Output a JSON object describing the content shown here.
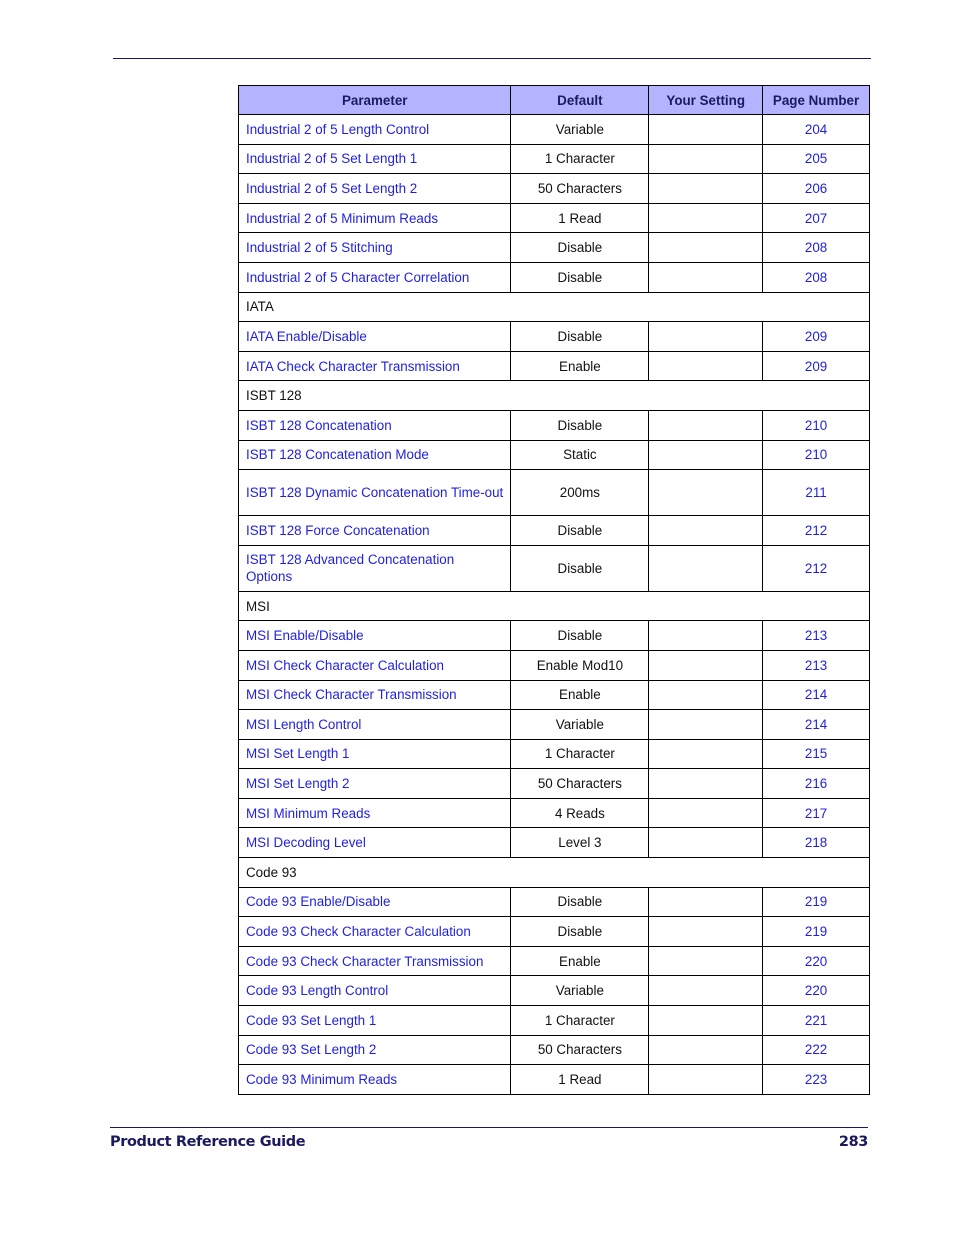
{
  "header": {
    "columns": [
      "Parameter",
      "Default",
      "Your Setting",
      "Page Number"
    ]
  },
  "rows": [
    {
      "type": "param",
      "parameter": "Industrial 2 of 5 Length Control",
      "default": "Variable",
      "setting": "",
      "page": "204"
    },
    {
      "type": "param",
      "parameter": "Industrial 2 of 5 Set Length 1",
      "default": "1 Character",
      "setting": "",
      "page": "205"
    },
    {
      "type": "param",
      "parameter": "Industrial 2 of 5 Set Length 2",
      "default": "50 Characters",
      "setting": "",
      "page": "206"
    },
    {
      "type": "param",
      "parameter": "Industrial 2 of 5 Minimum Reads",
      "default": "1 Read",
      "setting": "",
      "page": "207"
    },
    {
      "type": "param",
      "parameter": "Industrial 2 of 5 Stitching",
      "default": "Disable",
      "setting": "",
      "page": "208"
    },
    {
      "type": "param",
      "parameter": "Industrial 2 of 5 Character Correlation",
      "default": "Disable",
      "setting": "",
      "page": "208"
    },
    {
      "type": "section",
      "label": "IATA"
    },
    {
      "type": "param",
      "parameter": "IATA Enable/Disable",
      "default": "Disable",
      "setting": "",
      "page": "209"
    },
    {
      "type": "param",
      "parameter": "IATA Check Character Transmission",
      "default": "Enable",
      "setting": "",
      "page": "209"
    },
    {
      "type": "section",
      "label": "ISBT 128"
    },
    {
      "type": "param",
      "parameter": "ISBT 128 Concatenation",
      "default": "Disable",
      "setting": "",
      "page": "210"
    },
    {
      "type": "param",
      "parameter": "ISBT 128 Concatenation Mode",
      "default": "Static",
      "setting": "",
      "page": "210"
    },
    {
      "type": "param",
      "tall": true,
      "parameter": "ISBT 128 Dynamic Concatenation Time-out",
      "default": "200ms",
      "setting": "",
      "page": "211"
    },
    {
      "type": "param",
      "parameter": "ISBT 128 Force Concatenation",
      "default": "Disable",
      "setting": "",
      "page": "212"
    },
    {
      "type": "param",
      "tall": true,
      "parameter": "ISBT 128 Advanced Concatenation Options",
      "default": "Disable",
      "setting": "",
      "page": "212"
    },
    {
      "type": "section",
      "label": "MSI"
    },
    {
      "type": "param",
      "parameter": "MSI Enable/Disable",
      "default": "Disable",
      "setting": "",
      "page": "213"
    },
    {
      "type": "param",
      "parameter": "MSI Check Character Calculation",
      "default": "Enable Mod10",
      "setting": "",
      "page": "213"
    },
    {
      "type": "param",
      "parameter": "MSI Check Character Transmission",
      "default": "Enable",
      "setting": "",
      "page": "214"
    },
    {
      "type": "param",
      "parameter": "MSI Length Control",
      "default": "Variable",
      "setting": "",
      "page": "214"
    },
    {
      "type": "param",
      "parameter": "MSI Set Length 1",
      "default": "1 Character",
      "setting": "",
      "page": "215"
    },
    {
      "type": "param",
      "parameter": "MSI Set Length 2",
      "default": "50 Characters",
      "setting": "",
      "page": "216"
    },
    {
      "type": "param",
      "parameter": "MSI Minimum Reads",
      "default": "4 Reads",
      "setting": "",
      "page": "217"
    },
    {
      "type": "param",
      "parameter": "MSI Decoding Level",
      "default": "Level 3",
      "setting": "",
      "page": "218"
    },
    {
      "type": "section",
      "label": "Code 93"
    },
    {
      "type": "param",
      "parameter": "Code 93 Enable/Disable",
      "default": "Disable",
      "setting": "",
      "page": "219"
    },
    {
      "type": "param",
      "parameter": "Code 93 Check Character Calculation",
      "default": "Disable",
      "setting": "",
      "page": "219"
    },
    {
      "type": "param",
      "parameter": "Code 93 Check Character Transmission",
      "default": "Enable",
      "setting": "",
      "page": "220"
    },
    {
      "type": "param",
      "parameter": "Code 93 Length Control",
      "default": "Variable",
      "setting": "",
      "page": "220"
    },
    {
      "type": "param",
      "parameter": "Code 93 Set Length 1",
      "default": "1 Character",
      "setting": "",
      "page": "221"
    },
    {
      "type": "param",
      "parameter": "Code 93 Set Length 2",
      "default": "50 Characters",
      "setting": "",
      "page": "222"
    },
    {
      "type": "param",
      "parameter": "Code 93 Minimum Reads",
      "default": "1 Read",
      "setting": "",
      "page": "223"
    }
  ],
  "footer": {
    "title": "Product Reference Guide",
    "page_number": "283"
  },
  "colors": {
    "header_fill": "#b3b3ff",
    "link": "#1f1fe0",
    "rule": "#1a1a5e"
  }
}
